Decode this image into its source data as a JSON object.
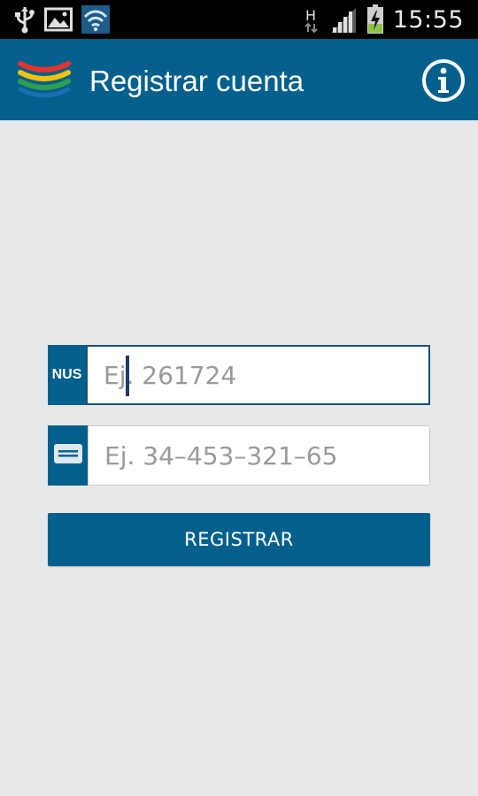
{
  "status_bar": {
    "time": "15:55",
    "network_type": "H",
    "icons": [
      "usb-icon",
      "image-icon",
      "wifi-icon",
      "network-arrows-icon",
      "signal-icon",
      "battery-charging-icon"
    ]
  },
  "action_bar": {
    "title": "Registrar cuenta",
    "logo": "app-logo-icon",
    "info_icon": "info-icon"
  },
  "form": {
    "nus": {
      "label": "NUS",
      "placeholder": "Ej. 261724",
      "value": ""
    },
    "card": {
      "label_icon": "card-icon",
      "placeholder": "Ej. 34–453–321–65",
      "value": ""
    },
    "submit_label": "REGISTRAR"
  },
  "colors": {
    "primary": "#03608c",
    "background": "#e7e8ea",
    "status_bar": "#000000"
  }
}
